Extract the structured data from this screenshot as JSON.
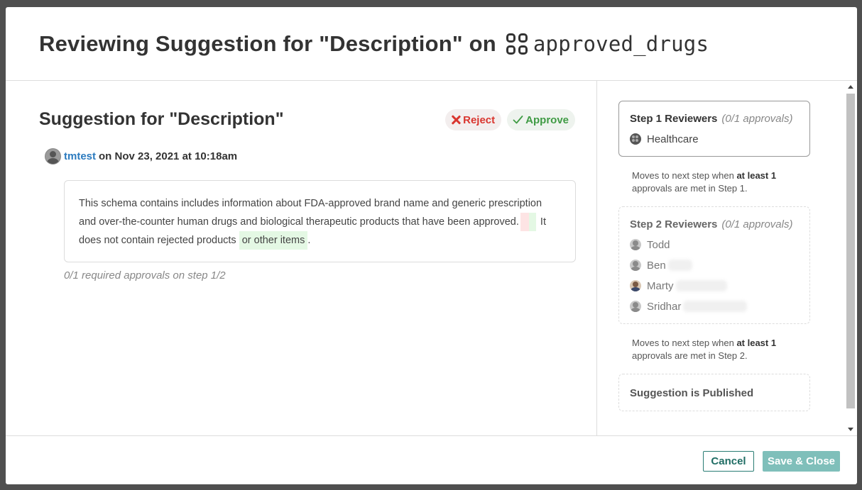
{
  "modal": {
    "title_prefix": "Reviewing Suggestion for \"Description\" on",
    "dataset_icon": "dataset-grid-icon",
    "dataset_name": "approved_drugs"
  },
  "suggestion": {
    "title": "Suggestion for \"Description\"",
    "reject_label": "Reject",
    "approve_label": "Approve",
    "author": "tmtest",
    "date_text": "on Nov 23, 2021 at 10:18am",
    "text_before": "This schema contains includes information about FDA-approved brand name and generic prescription and over-the-counter human drugs and biological therapeutic products that have been approved.",
    "text_middle": "It does not contain rejected products",
    "inserted_text": "or other items",
    "text_end": ".",
    "approvals_note": "0/1 required approvals on step 1/2",
    "colors": {
      "reject": "#d9352f",
      "approve": "#3f9b44",
      "deleted_bg": "#fde4e4",
      "inserted_bg": "#e4f8e4"
    }
  },
  "steps": [
    {
      "title": "Step 1 Reviewers",
      "count": "(0/1 approvals)",
      "reviewers": [
        {
          "name": "Healthcare",
          "icon": "group-icon"
        }
      ],
      "hint_prefix": "Moves to next step when",
      "hint_bold": "at least 1",
      "hint_suffix": "approvals are met in Step 1."
    },
    {
      "title": "Step 2 Reviewers",
      "count": "(0/1 approvals)",
      "reviewers": [
        {
          "name": "Todd",
          "icon": "user-icon"
        },
        {
          "name": "Ben",
          "icon": "user-icon"
        },
        {
          "name": "Marty",
          "icon": "user-photo-icon"
        },
        {
          "name": "Sridhar",
          "icon": "user-icon"
        }
      ],
      "hint_prefix": "Moves to next step when",
      "hint_bold": "at least 1",
      "hint_suffix": "approvals are met in Step 2."
    }
  ],
  "published_label": "Suggestion is Published",
  "footer": {
    "cancel_label": "Cancel",
    "save_label": "Save & Close",
    "accent": "#2a7d74"
  }
}
